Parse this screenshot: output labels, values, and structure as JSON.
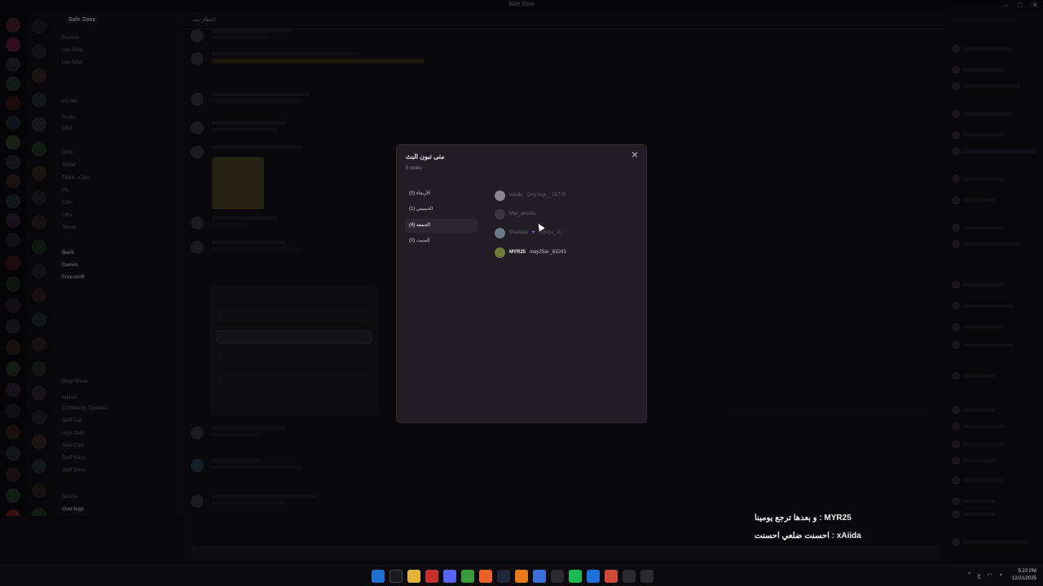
{
  "window": {
    "title": "Safe Zone"
  },
  "server": {
    "name": "Safe Zone"
  },
  "channels": [
    "Promos",
    "Live Rust",
    "Live Now",
    "Put Me",
    "Public",
    "Chat",
    "Drink",
    "Shikar",
    "Tiktok - Clips",
    "Pic",
    "Clips",
    "Gifts",
    "Streak",
    "Bank",
    "Games",
    "Free-stuff",
    "Deep Sleep",
    "Advice",
    "Community Updates",
    "Staff-Call",
    "High-Staff",
    "Staff-Chat",
    "Staff Voice",
    "Staff Voice",
    "Admins",
    "chat-logs"
  ],
  "chat": {
    "channel": "انتظار-بث"
  },
  "modal": {
    "title": "متى تبون البث",
    "votes": "5 votes",
    "answers": [
      {
        "label": "الأربعاء (0)",
        "active": false
      },
      {
        "label": "الخميس (1)",
        "active": false
      },
      {
        "label": "الجمعة (4)",
        "active": true
      },
      {
        "label": "السبت (0)",
        "active": false
      }
    ],
    "voters": [
      {
        "display": "xAiida",
        "user": "Only.legs__55729",
        "active": false,
        "color": "#8a8690"
      },
      {
        "display": "Mar_anosfa",
        "user": "",
        "active": false,
        "color": "#3a3640"
      },
      {
        "display": "Ghaidaa",
        "user": "mariya_10",
        "active": false,
        "color": "#6b7a88"
      },
      {
        "display": "MYR25",
        "user": "may25ar._63243",
        "active": true,
        "color": "#6e7a3a"
      }
    ]
  },
  "overlay": {
    "line1": "و بعدها ترجع يومينا : MYR25",
    "line2": "احسنت ضلعي احسنت : xAiida"
  },
  "taskbar": {
    "time": "5:22 PM",
    "date": "12/21/2025",
    "lang": "ع"
  }
}
